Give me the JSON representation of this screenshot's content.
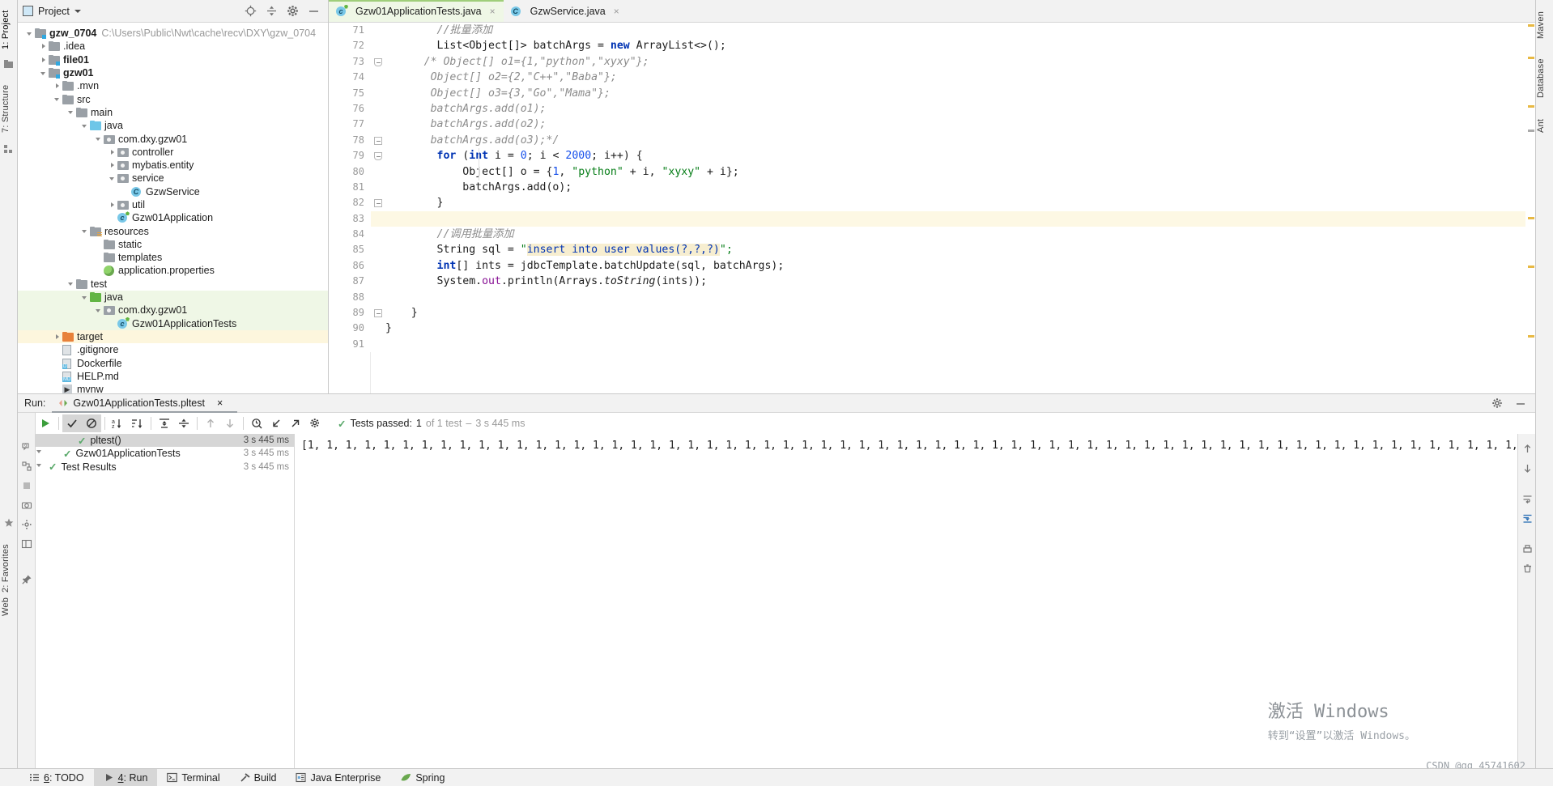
{
  "left_strip": {
    "tabs": [
      {
        "label": "1: Project",
        "icon": "project-icon",
        "selected": true
      },
      {
        "label": "7: Structure",
        "icon": "structure-icon",
        "selected": false
      },
      {
        "label": "2: Favorites",
        "icon": "star-icon",
        "selected": false
      },
      {
        "label": "Web",
        "icon": "web-icon",
        "selected": false
      }
    ]
  },
  "right_strip": {
    "tabs": [
      {
        "label": "Maven",
        "icon": "maven-icon"
      },
      {
        "label": "Database",
        "icon": "database-icon"
      },
      {
        "label": "Ant",
        "icon": "ant-icon"
      }
    ]
  },
  "project_panel": {
    "title": "Project",
    "icons": [
      "locate-icon",
      "collapse-all-icon",
      "settings-gear-icon",
      "hide-icon"
    ],
    "tree": [
      {
        "label": "gzw_0704",
        "path": "C:\\Users\\Public\\Nwt\\cache\\recv\\DXY\\gzw_0704",
        "depth": 0,
        "arrow": "open",
        "icon": "module-folder",
        "bold": true
      },
      {
        "label": ".idea",
        "depth": 1,
        "arrow": "closed",
        "icon": "folder-grey"
      },
      {
        "label": "file01",
        "depth": 1,
        "arrow": "closed",
        "icon": "module-folder",
        "bold": true
      },
      {
        "label": "gzw01",
        "depth": 1,
        "arrow": "open",
        "icon": "module-folder",
        "bold": true
      },
      {
        "label": ".mvn",
        "depth": 2,
        "arrow": "closed",
        "icon": "folder-grey"
      },
      {
        "label": "src",
        "depth": 2,
        "arrow": "open",
        "icon": "folder-grey"
      },
      {
        "label": "main",
        "depth": 3,
        "arrow": "open",
        "icon": "folder-grey"
      },
      {
        "label": "java",
        "depth": 4,
        "arrow": "open",
        "icon": "folder-blue"
      },
      {
        "label": "com.dxy.gzw01",
        "depth": 5,
        "arrow": "open",
        "icon": "package-icon"
      },
      {
        "label": "controller",
        "depth": 6,
        "arrow": "closed",
        "icon": "package-icon"
      },
      {
        "label": "mybatis.entity",
        "depth": 6,
        "arrow": "closed",
        "icon": "package-icon"
      },
      {
        "label": "service",
        "depth": 6,
        "arrow": "open",
        "icon": "package-icon"
      },
      {
        "label": "GzwService",
        "depth": 7,
        "arrow": "none",
        "icon": "class-icon"
      },
      {
        "label": "util",
        "depth": 6,
        "arrow": "closed",
        "icon": "package-icon"
      },
      {
        "label": "Gzw01Application",
        "depth": 6,
        "arrow": "none",
        "icon": "spring-class-icon"
      },
      {
        "label": "resources",
        "depth": 4,
        "arrow": "open",
        "icon": "resources-folder"
      },
      {
        "label": "static",
        "depth": 5,
        "arrow": "none",
        "icon": "folder-grey"
      },
      {
        "label": "templates",
        "depth": 5,
        "arrow": "none",
        "icon": "folder-grey"
      },
      {
        "label": "application.properties",
        "depth": 5,
        "arrow": "none",
        "icon": "spring-props-icon"
      },
      {
        "label": "test",
        "depth": 3,
        "arrow": "open",
        "icon": "folder-grey"
      },
      {
        "label": "java",
        "depth": 4,
        "arrow": "open",
        "icon": "folder-green",
        "highlight": "green"
      },
      {
        "label": "com.dxy.gzw01",
        "depth": 5,
        "arrow": "open",
        "icon": "package-icon",
        "highlight": "green"
      },
      {
        "label": "Gzw01ApplicationTests",
        "depth": 6,
        "arrow": "none",
        "icon": "test-class-icon",
        "highlight": "green"
      },
      {
        "label": "target",
        "depth": 2,
        "arrow": "closed",
        "icon": "folder-orange",
        "highlight": "yellow"
      },
      {
        "label": ".gitignore",
        "depth": 2,
        "arrow": "none",
        "icon": "gitignore-icon"
      },
      {
        "label": "Dockerfile",
        "depth": 2,
        "arrow": "none",
        "icon": "docker-file-icon"
      },
      {
        "label": "HELP.md",
        "depth": 2,
        "arrow": "none",
        "icon": "markdown-file-icon"
      },
      {
        "label": "mvnw",
        "depth": 2,
        "arrow": "none",
        "icon": "script-file-icon"
      }
    ]
  },
  "editor": {
    "tabs": [
      {
        "label": "Gzw01ApplicationTests.java",
        "icon": "test-class-icon",
        "active": true,
        "close": "×"
      },
      {
        "label": "GzwService.java",
        "icon": "class-icon",
        "active": false,
        "close": "×"
      }
    ],
    "first_line_number": 71,
    "lines": [
      {
        "n": 71,
        "segs": [
          {
            "t": "        ",
            "c": "plain"
          },
          {
            "t": "//批量添加",
            "c": "cmt"
          }
        ]
      },
      {
        "n": 72,
        "segs": [
          {
            "t": "        List<Object[]> batchArgs = ",
            "c": "plain"
          },
          {
            "t": "new",
            "c": "kw"
          },
          {
            "t": " ArrayList<>();",
            "c": "plain"
          }
        ]
      },
      {
        "n": 73,
        "fold": "start",
        "segs": [
          {
            "t": "      /* Object[] o1={1,\"python\",\"xyxy\"};",
            "c": "blk"
          }
        ]
      },
      {
        "n": 74,
        "segs": [
          {
            "t": "       Object[] o2={2,\"C++\",\"Baba\"};",
            "c": "blk"
          }
        ]
      },
      {
        "n": 75,
        "segs": [
          {
            "t": "       Object[] o3={3,\"Go\",\"Mama\"};",
            "c": "blk"
          }
        ]
      },
      {
        "n": 76,
        "segs": [
          {
            "t": "       batchArgs.add(o1);",
            "c": "blk"
          }
        ]
      },
      {
        "n": 77,
        "segs": [
          {
            "t": "       batchArgs.add(o2);",
            "c": "blk"
          }
        ]
      },
      {
        "n": 78,
        "fold": "end",
        "segs": [
          {
            "t": "       batchArgs.add(o3);*/",
            "c": "blk"
          }
        ]
      },
      {
        "n": 79,
        "fold": "start",
        "segs": [
          {
            "t": "        ",
            "c": "plain"
          },
          {
            "t": "for",
            "c": "kw"
          },
          {
            "t": " (",
            "c": "plain"
          },
          {
            "t": "int",
            "c": "kw"
          },
          {
            "t": " i = ",
            "c": "plain"
          },
          {
            "t": "0",
            "c": "num"
          },
          {
            "t": "; i < ",
            "c": "plain"
          },
          {
            "t": "2000",
            "c": "num"
          },
          {
            "t": "; i++) {",
            "c": "plain"
          }
        ]
      },
      {
        "n": 80,
        "segs": [
          {
            "t": "            Object[] o = {",
            "c": "plain"
          },
          {
            "t": "1",
            "c": "num"
          },
          {
            "t": ", ",
            "c": "plain"
          },
          {
            "t": "\"python\"",
            "c": "str"
          },
          {
            "t": " + i, ",
            "c": "plain"
          },
          {
            "t": "\"xyxy\"",
            "c": "str"
          },
          {
            "t": " + i};",
            "c": "plain"
          }
        ]
      },
      {
        "n": 81,
        "segs": [
          {
            "t": "            batchArgs.add(o);",
            "c": "plain"
          }
        ]
      },
      {
        "n": 82,
        "fold": "end",
        "segs": [
          {
            "t": "        }",
            "c": "plain"
          }
        ]
      },
      {
        "n": 83,
        "highlight": true,
        "segs": [
          {
            "t": "",
            "c": "plain"
          }
        ]
      },
      {
        "n": 84,
        "segs": [
          {
            "t": "        ",
            "c": "plain"
          },
          {
            "t": "//调用批量添加",
            "c": "cmt"
          }
        ]
      },
      {
        "n": 85,
        "segs": [
          {
            "t": "        String sql = ",
            "c": "plain"
          },
          {
            "t": "\"",
            "c": "str"
          },
          {
            "t": "insert into user values(?,?,?)",
            "c": "sql"
          },
          {
            "t": "\";",
            "c": "str"
          }
        ]
      },
      {
        "n": 86,
        "segs": [
          {
            "t": "        ",
            "c": "plain"
          },
          {
            "t": "int",
            "c": "kw"
          },
          {
            "t": "[] ints = jdbcTemplate.batchUpdate(sql, batchArgs);",
            "c": "plain"
          }
        ]
      },
      {
        "n": 87,
        "segs": [
          {
            "t": "        System.",
            "c": "plain"
          },
          {
            "t": "out",
            "c": "fld"
          },
          {
            "t": ".println(Arrays.",
            "c": "plain"
          },
          {
            "t": "toString",
            "c": "ital"
          },
          {
            "t": "(ints));",
            "c": "plain"
          }
        ]
      },
      {
        "n": 88,
        "segs": [
          {
            "t": "",
            "c": "plain"
          }
        ]
      },
      {
        "n": 89,
        "fold": "end",
        "segs": [
          {
            "t": "    }",
            "c": "plain"
          }
        ]
      },
      {
        "n": 90,
        "segs": [
          {
            "t": "}",
            "c": "plain"
          }
        ]
      },
      {
        "n": 91,
        "segs": [
          {
            "t": "",
            "c": "plain"
          }
        ]
      }
    ]
  },
  "run_panel": {
    "label": "Run:",
    "tab_title": "Gzw01ApplicationTests.pltest",
    "tab_close": "×",
    "toolbar_icons": [
      "rerun-icon",
      "show-passed-icon",
      "ignore-tests-icon",
      "sort-alpha-icon",
      "sort-duration-icon",
      "expand-all-icon",
      "collapse-all-icon",
      "prev-test-icon",
      "next-test-icon",
      "history-icon",
      "import-icon",
      "export-icon",
      "settings-gear-icon"
    ],
    "status": {
      "passed_label": "Tests passed:",
      "passed_count": "1",
      "of_text": "of 1 test",
      "sep": "–",
      "duration": "3 s 445 ms"
    },
    "tests": [
      {
        "label": "Test Results",
        "time": "3 s 445 ms",
        "depth": 0,
        "arrow": "open",
        "selected": false
      },
      {
        "label": "Gzw01ApplicationTests",
        "time": "3 s 445 ms",
        "depth": 1,
        "arrow": "open",
        "selected": false
      },
      {
        "label": "pltest()",
        "time": "3 s 445 ms",
        "depth": 2,
        "arrow": "none",
        "selected": true
      }
    ],
    "console_output": "[1, 1, 1, 1, 1, 1, 1, 1, 1, 1, 1, 1, 1, 1, 1, 1, 1, 1, 1, 1, 1, 1, 1, 1, 1, 1, 1, 1, 1, 1, 1, 1, 1, 1, 1, 1, 1, 1, 1, 1, 1, 1, 1, 1, 1, 1, 1, 1, 1, 1, 1, 1, 1, 1, 1, 1, 1, 1, 1, 1, 1, 1, 1, 1, 1, 1, 1,",
    "right_icons": [
      "scroll-up-icon",
      "scroll-down-icon",
      "soft-wrap-icon",
      "scroll-to-end-icon",
      "print-icon",
      "clear-all-icon"
    ],
    "left_icons": [
      "collapse-frame-icon",
      "rerun-failed-icon",
      "stop-icon",
      "camera-icon",
      "settings-icon",
      "layout-icon",
      "pin-icon"
    ],
    "header_right_icons": [
      "settings-gear-icon",
      "minimize-icon"
    ]
  },
  "watermark": {
    "line1": "激活 Windows",
    "line2": "转到“设置”以激活 Windows。"
  },
  "csdn": "CSDN @qq_45741602",
  "status_bar": {
    "items": [
      {
        "label": "6: TODO",
        "icon": "todo-icon",
        "active": false,
        "mnemonic": "6"
      },
      {
        "label": "4: Run",
        "icon": "run-icon",
        "active": true,
        "mnemonic": "4"
      },
      {
        "label": "Terminal",
        "icon": "terminal-icon",
        "active": false
      },
      {
        "label": "Build",
        "icon": "build-hammer-icon",
        "active": false
      },
      {
        "label": "Java Enterprise",
        "icon": "java-enterprise-icon",
        "active": false
      },
      {
        "label": "Spring",
        "icon": "spring-leaf-icon",
        "active": false
      }
    ]
  },
  "colors": {
    "accent_green": "#62b543",
    "tab_active_bg": "#eff7e6",
    "selection_grey": "#d6d6d6",
    "highlight_yellow": "#fdf8e4",
    "keyword_blue": "#0033b3",
    "string_green": "#067d17"
  }
}
